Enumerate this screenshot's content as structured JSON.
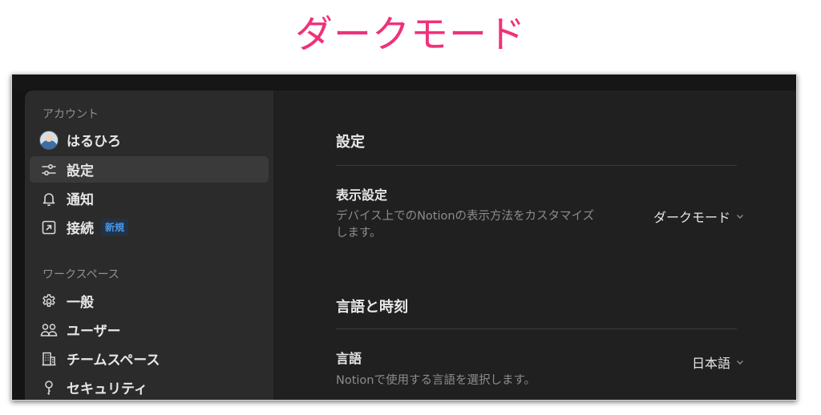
{
  "caption": "ダークモード",
  "sidebar": {
    "account_section": "アカウント",
    "account_items": [
      {
        "label": "はるひろ",
        "icon": "avatar"
      },
      {
        "label": "設定",
        "icon": "sliders-icon",
        "active": true
      },
      {
        "label": "通知",
        "icon": "bell-icon"
      },
      {
        "label": "接続",
        "icon": "external-link-icon",
        "badge": "新規"
      }
    ],
    "workspace_section": "ワークスペース",
    "workspace_items": [
      {
        "label": "一般",
        "icon": "gear-icon"
      },
      {
        "label": "ユーザー",
        "icon": "users-icon"
      },
      {
        "label": "チームスペース",
        "icon": "building-icon"
      },
      {
        "label": "セキュリティ",
        "icon": "key-icon"
      }
    ]
  },
  "content": {
    "settings_title": "設定",
    "display": {
      "title": "表示設定",
      "description": "デバイス上でのNotionの表示方法をカスタマイズします。",
      "value": "ダークモード"
    },
    "language_section_title": "言語と時刻",
    "language": {
      "title": "言語",
      "description": "Notionで使用する言語を選択します。",
      "value": "日本語"
    }
  },
  "colors": {
    "caption": "#f0317a",
    "sidebar_bg": "#2b2b2b",
    "content_bg": "#202020",
    "badge_text": "#4c98e8"
  }
}
